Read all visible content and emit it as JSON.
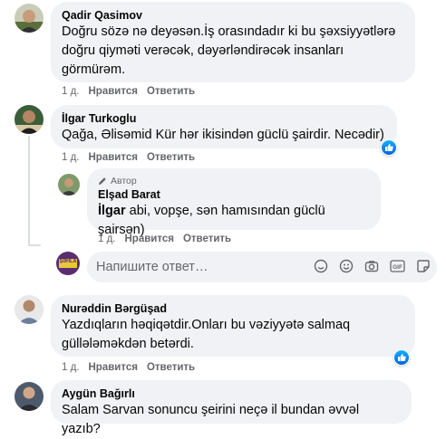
{
  "comments": [
    {
      "author": "Qadir Qasimov",
      "text": "Doğru sözə nə deyəsən.İş orasındadır ki bu şəxsiyyətlərə doğru qiyməti verəcək, dəyərləndirəcək insanları görmürəm.",
      "time": "1 д.",
      "like_label": "Нравится",
      "reply_label": "Ответить"
    },
    {
      "author": "İlgar Turkoglu",
      "text": "Qağa, Əlisəmid Kür hər ikisindən güclü şairdir. Necədir)",
      "time": "1 д.",
      "like_label": "Нравится",
      "reply_label": "Ответить"
    },
    {
      "author_badge": "Автор",
      "author": "Elşad Barat",
      "mention": "İlgar",
      "text": " abi, vopşe, sən hamısından güclü şairsən)",
      "time": "1 д.",
      "like_label": "Нравится",
      "reply_label": "Ответить"
    },
    {
      "author": "Nurəddin Bərgüşad",
      "text": "Yazdıqların həqiqətdir.Onları bu vəziyyətə salmaq güllələməkdən betərdi.",
      "time": "1 д.",
      "like_label": "Нравится",
      "reply_label": "Ответить"
    },
    {
      "author": "Aygün Bağırlı",
      "text": "Salam Sarvan sonuncu şeirini neçə il bundan əvvəl yazıb?"
    }
  ],
  "reply_input": {
    "placeholder": "Напишите ответ…",
    "avatar_label": "ŞƏHLA"
  },
  "icons": [
    "pencil-icon",
    "like-icon",
    "sticker-icon",
    "emoji-icon",
    "camera-icon",
    "gif-icon",
    "stickers-icon"
  ],
  "colors": {
    "bubble": "#f0f2f5",
    "meta": "#65676b",
    "like_blue": "#1877f2"
  }
}
